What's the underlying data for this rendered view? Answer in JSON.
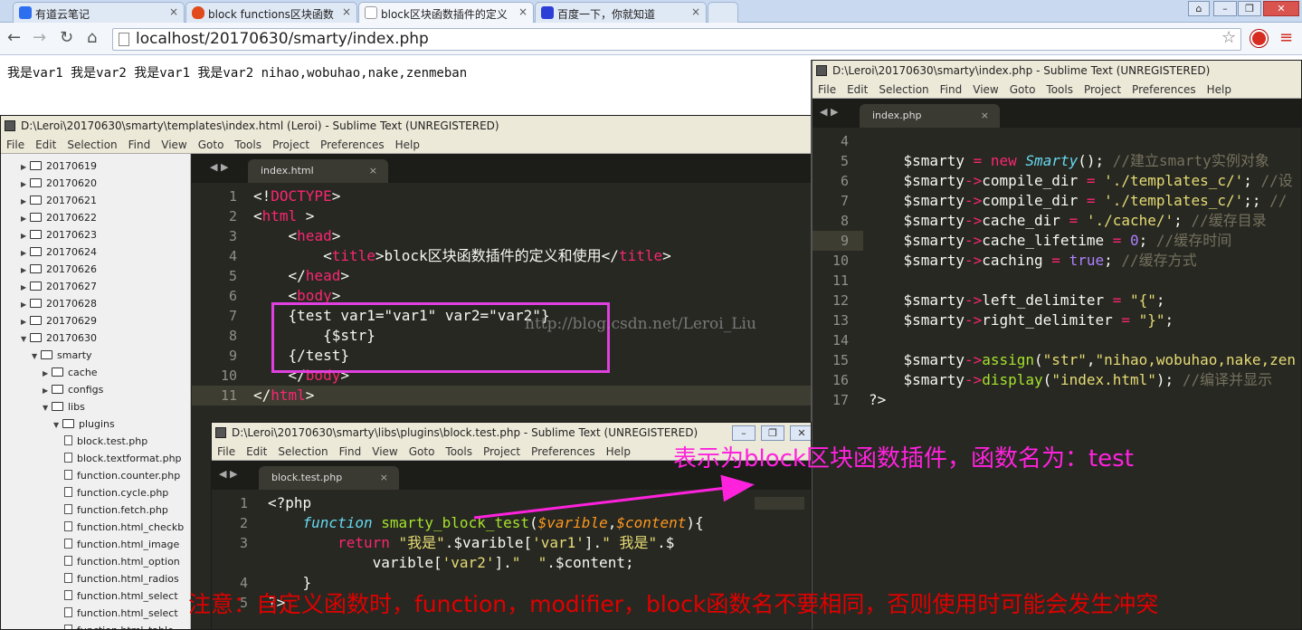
{
  "browser": {
    "tabs": [
      {
        "label": "有道云笔记",
        "icon": "youdao-note-icon",
        "color": "#2e6ff0"
      },
      {
        "label": "block functions区块函数",
        "icon": "flame-icon",
        "color": "#e04a1c"
      },
      {
        "label": "block区块函数插件的定义",
        "icon": "document-icon",
        "color": "#ffffff"
      },
      {
        "label": "百度一下，你就知道",
        "icon": "baidu-paw-icon",
        "color": "#2b3fd8"
      }
    ],
    "close_glyph": "×",
    "url": "localhost/20170630/smarty/index.php",
    "page_text": "我是var1 我是var2 我是var1 我是var2 nihao,wobuhao,nake,zenmeban"
  },
  "left_window": {
    "title": "D:\\Leroi\\20170630\\smarty\\templates\\index.html (Leroi) - Sublime Text (UNREGISTERED)",
    "menu": [
      "File",
      "Edit",
      "Selection",
      "Find",
      "View",
      "Goto",
      "Tools",
      "Project",
      "Preferences",
      "Help"
    ],
    "tab": "index.html",
    "sidebar": [
      {
        "label": "20170619",
        "type": "folder",
        "depth": 0,
        "open": false
      },
      {
        "label": "20170620",
        "type": "folder",
        "depth": 0,
        "open": false
      },
      {
        "label": "20170621",
        "type": "folder",
        "depth": 0,
        "open": false
      },
      {
        "label": "20170622",
        "type": "folder",
        "depth": 0,
        "open": false
      },
      {
        "label": "20170623",
        "type": "folder",
        "depth": 0,
        "open": false
      },
      {
        "label": "20170624",
        "type": "folder",
        "depth": 0,
        "open": false
      },
      {
        "label": "20170626",
        "type": "folder",
        "depth": 0,
        "open": false
      },
      {
        "label": "20170627",
        "type": "folder",
        "depth": 0,
        "open": false
      },
      {
        "label": "20170628",
        "type": "folder",
        "depth": 0,
        "open": false
      },
      {
        "label": "20170629",
        "type": "folder",
        "depth": 0,
        "open": false
      },
      {
        "label": "20170630",
        "type": "folder",
        "depth": 0,
        "open": true
      },
      {
        "label": "smarty",
        "type": "folder",
        "depth": 1,
        "open": true
      },
      {
        "label": "cache",
        "type": "folder",
        "depth": 2,
        "open": false
      },
      {
        "label": "configs",
        "type": "folder",
        "depth": 2,
        "open": false
      },
      {
        "label": "libs",
        "type": "folder",
        "depth": 2,
        "open": true
      },
      {
        "label": "plugins",
        "type": "folder",
        "depth": 3,
        "open": true
      },
      {
        "label": "block.test.php",
        "type": "file",
        "depth": 4
      },
      {
        "label": "block.textformat.php",
        "type": "file",
        "depth": 4
      },
      {
        "label": "function.counter.php",
        "type": "file",
        "depth": 4
      },
      {
        "label": "function.cycle.php",
        "type": "file",
        "depth": 4
      },
      {
        "label": "function.fetch.php",
        "type": "file",
        "depth": 4
      },
      {
        "label": "function.html_checkb",
        "type": "file",
        "depth": 4
      },
      {
        "label": "function.html_image",
        "type": "file",
        "depth": 4
      },
      {
        "label": "function.html_option",
        "type": "file",
        "depth": 4
      },
      {
        "label": "function.html_radios",
        "type": "file",
        "depth": 4
      },
      {
        "label": "function.html_select",
        "type": "file",
        "depth": 4
      },
      {
        "label": "function.html_select",
        "type": "file",
        "depth": 4
      },
      {
        "label": "function.html_table",
        "type": "file",
        "depth": 4
      }
    ],
    "line_numbers": [
      "1",
      "2",
      "3",
      "4",
      "5",
      "6",
      "7",
      "8",
      "9",
      "10",
      "11"
    ],
    "code": [
      [
        [
          "p0",
          "<!"
        ],
        [
          "k",
          "DOCTYPE"
        ],
        [
          "p0",
          ">"
        ]
      ],
      [
        [
          "p0",
          "<"
        ],
        [
          "k",
          "html"
        ],
        [
          "p0",
          " >"
        ]
      ],
      [
        [
          "p0",
          "    <"
        ],
        [
          "k",
          "head"
        ],
        [
          "p0",
          ">"
        ]
      ],
      [
        [
          "p0",
          "        <"
        ],
        [
          "k",
          "title"
        ],
        [
          "p0",
          ">block区块函数插件的定义和使用</"
        ],
        [
          "k",
          "title"
        ],
        [
          "p0",
          ">"
        ]
      ],
      [
        [
          "p0",
          "    </"
        ],
        [
          "k",
          "head"
        ],
        [
          "p0",
          ">"
        ]
      ],
      [
        [
          "p0",
          "    <"
        ],
        [
          "k",
          "body"
        ],
        [
          "p0",
          ">"
        ]
      ],
      [
        [
          "p0",
          "    {test var1=\"var1\" var2=\"var2\"}"
        ]
      ],
      [
        [
          "p0",
          "        {$str}"
        ]
      ],
      [
        [
          "p0",
          "    {/test}"
        ]
      ],
      [
        [
          "p0",
          "    </"
        ],
        [
          "k",
          "body"
        ],
        [
          "p0",
          ">"
        ]
      ],
      [
        [
          "p0",
          "</"
        ],
        [
          "k",
          "html"
        ],
        [
          "p0",
          ">"
        ]
      ]
    ]
  },
  "right_window": {
    "title": "D:\\Leroi\\20170630\\smarty\\index.php - Sublime Text (UNREGISTERED)",
    "menu": [
      "File",
      "Edit",
      "Selection",
      "Find",
      "View",
      "Goto",
      "Tools",
      "Project",
      "Preferences",
      "Help"
    ],
    "tab": "index.php",
    "line_numbers": [
      "4",
      "5",
      "6",
      "7",
      "8",
      "9",
      "10",
      "11",
      "12",
      "13",
      "14",
      "15",
      "16",
      "17"
    ],
    "code": [
      [
        [
          "p0",
          ""
        ]
      ],
      [
        [
          "p0",
          "    $smarty "
        ],
        [
          "k",
          "="
        ],
        [
          "p0",
          " "
        ],
        [
          "k",
          "new"
        ],
        [
          "p0",
          " "
        ],
        [
          "t",
          "Smarty"
        ],
        [
          "p0",
          "(); "
        ],
        [
          "c",
          "//建立smarty实例对象"
        ]
      ],
      [
        [
          "p0",
          "    $smarty"
        ],
        [
          "k",
          "->"
        ],
        [
          "p0",
          "compile_dir "
        ],
        [
          "k",
          "="
        ],
        [
          "p0",
          " "
        ],
        [
          "s",
          "'./templates_c/'"
        ],
        [
          "p0",
          "; "
        ],
        [
          "c",
          "//设"
        ]
      ],
      [
        [
          "p0",
          "    $smarty"
        ],
        [
          "k",
          "->"
        ],
        [
          "p0",
          "compile_dir "
        ],
        [
          "k",
          "="
        ],
        [
          "p0",
          " "
        ],
        [
          "s",
          "'./templates_c/'"
        ],
        [
          "p0",
          ";; "
        ],
        [
          "c",
          "//"
        ]
      ],
      [
        [
          "p0",
          "    $smarty"
        ],
        [
          "k",
          "->"
        ],
        [
          "p0",
          "cache_dir "
        ],
        [
          "k",
          "="
        ],
        [
          "p0",
          " "
        ],
        [
          "s",
          "'./cache/'"
        ],
        [
          "p0",
          "; "
        ],
        [
          "c",
          "//缓存目录"
        ]
      ],
      [
        [
          "p0",
          "    $smarty"
        ],
        [
          "k",
          "->"
        ],
        [
          "p0",
          "cache_lifetime "
        ],
        [
          "k",
          "="
        ],
        [
          "p0",
          " "
        ],
        [
          "b",
          "0"
        ],
        [
          "p0",
          "; "
        ],
        [
          "c",
          "//缓存时间"
        ]
      ],
      [
        [
          "p0",
          "    $smarty"
        ],
        [
          "k",
          "->"
        ],
        [
          "p0",
          "caching "
        ],
        [
          "k",
          "="
        ],
        [
          "p0",
          " "
        ],
        [
          "b",
          "true"
        ],
        [
          "p0",
          "; "
        ],
        [
          "c",
          "//缓存方式"
        ]
      ],
      [
        [
          "p0",
          ""
        ]
      ],
      [
        [
          "p0",
          "    $smarty"
        ],
        [
          "k",
          "->"
        ],
        [
          "p0",
          "left_delimiter "
        ],
        [
          "k",
          "="
        ],
        [
          "p0",
          " "
        ],
        [
          "s",
          "\"{\""
        ],
        [
          "p0",
          ";"
        ]
      ],
      [
        [
          "p0",
          "    $smarty"
        ],
        [
          "k",
          "->"
        ],
        [
          "p0",
          "right_delimiter "
        ],
        [
          "k",
          "="
        ],
        [
          "p0",
          " "
        ],
        [
          "s",
          "\"}\""
        ],
        [
          "p0",
          ";"
        ]
      ],
      [
        [
          "p0",
          ""
        ]
      ],
      [
        [
          "p0",
          "    $smarty"
        ],
        [
          "k",
          "->"
        ],
        [
          "f",
          "assign"
        ],
        [
          "p0",
          "("
        ],
        [
          "s",
          "\"str\""
        ],
        [
          "p0",
          ","
        ],
        [
          "s",
          "\"nihao,wobuhao,nake,zen"
        ]
      ],
      [
        [
          "p0",
          "    $smarty"
        ],
        [
          "k",
          "->"
        ],
        [
          "f",
          "display"
        ],
        [
          "p0",
          "("
        ],
        [
          "s",
          "\"index.html\""
        ],
        [
          "p0",
          "); "
        ],
        [
          "c",
          "//编译并显示"
        ]
      ],
      [
        [
          "p0",
          "?>"
        ]
      ]
    ]
  },
  "bottom_window": {
    "title": "D:\\Leroi\\20170630\\smarty\\libs\\plugins\\block.test.php - Sublime Text (UNREGISTERED)",
    "menu": [
      "File",
      "Edit",
      "Selection",
      "Find",
      "View",
      "Goto",
      "Tools",
      "Project",
      "Preferences",
      "Help"
    ],
    "tab": "block.test.php",
    "line_numbers": [
      "1",
      "2",
      "3",
      "",
      "4",
      "5"
    ],
    "code": [
      [
        [
          "p0",
          "<?php"
        ]
      ],
      [
        [
          "p0",
          "    "
        ],
        [
          "t",
          "function"
        ],
        [
          "p0",
          " "
        ],
        [
          "f",
          "smarty_block_test"
        ],
        [
          "p0",
          "("
        ],
        [
          "p",
          "$varible"
        ],
        [
          "p0",
          ","
        ],
        [
          "p",
          "$content"
        ],
        [
          "p0",
          "){"
        ]
      ],
      [
        [
          "p0",
          "        "
        ],
        [
          "k",
          "return"
        ],
        [
          "p0",
          " "
        ],
        [
          "s",
          "\"我是\""
        ],
        [
          "p0",
          "."
        ],
        [
          "p0",
          "$varible["
        ],
        [
          "s",
          "'var1'"
        ],
        [
          "p0",
          "]."
        ],
        [
          "s",
          "\" 我是\""
        ],
        [
          "p0",
          "."
        ],
        [
          "p0",
          "$"
        ]
      ],
      [
        [
          "p0",
          "            varible["
        ],
        [
          "s",
          "'var2'"
        ],
        [
          "p0",
          "]."
        ],
        [
          "s",
          "\"  \""
        ],
        [
          "p0",
          "."
        ],
        [
          "p0",
          "$content;"
        ]
      ],
      [
        [
          "p0",
          "    }"
        ]
      ],
      [
        [
          "p0",
          "?>"
        ]
      ]
    ]
  },
  "annotations": {
    "pink": "表示为block区块函数插件，函数名为：test",
    "red": "注意：自定义函数时，function，modifier，block函数名不要相同，否则使用时可能会发生冲突",
    "watermark": "http://blog.csdn.net/Leroi_Liu",
    "highlight_color": "#e040e0"
  }
}
